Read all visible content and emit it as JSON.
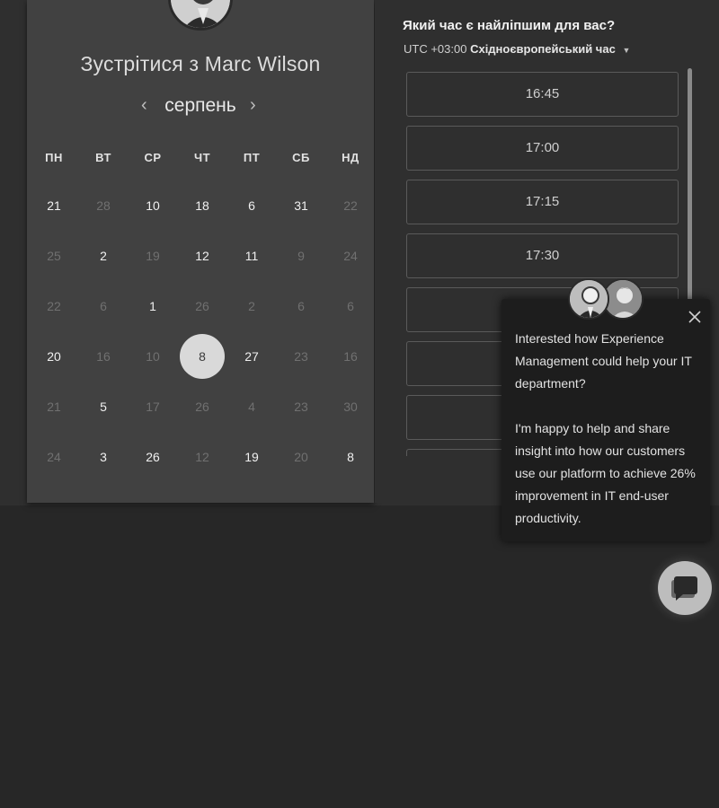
{
  "calendar": {
    "title": "Зустрітися з Marc Wilson",
    "month": "серпень",
    "prev_arrow": "‹",
    "next_arrow": "›",
    "weekdays": [
      "ПН",
      "ВТ",
      "СР",
      "ЧТ",
      "ПТ",
      "СБ",
      "НД"
    ],
    "weeks": [
      [
        {
          "d": "21",
          "dim": false
        },
        {
          "d": "28",
          "dim": true
        },
        {
          "d": "10",
          "dim": false
        },
        {
          "d": "18",
          "dim": false
        },
        {
          "d": "6",
          "dim": false
        },
        {
          "d": "31",
          "dim": false
        },
        {
          "d": "22",
          "dim": true
        }
      ],
      [
        {
          "d": "25",
          "dim": true
        },
        {
          "d": "2",
          "dim": false
        },
        {
          "d": "19",
          "dim": true
        },
        {
          "d": "12",
          "dim": false
        },
        {
          "d": "11",
          "dim": false
        },
        {
          "d": "9",
          "dim": true
        },
        {
          "d": "24",
          "dim": true
        }
      ],
      [
        {
          "d": "22",
          "dim": true
        },
        {
          "d": "6",
          "dim": true
        },
        {
          "d": "1",
          "dim": false
        },
        {
          "d": "26",
          "dim": true
        },
        {
          "d": "2",
          "dim": true
        },
        {
          "d": "6",
          "dim": true
        },
        {
          "d": "6",
          "dim": true
        }
      ],
      [
        {
          "d": "20",
          "dim": false
        },
        {
          "d": "16",
          "dim": true
        },
        {
          "d": "10",
          "dim": true
        },
        {
          "d": "8",
          "dim": false,
          "selected": true
        },
        {
          "d": "27",
          "dim": false
        },
        {
          "d": "23",
          "dim": true
        },
        {
          "d": "16",
          "dim": true
        }
      ],
      [
        {
          "d": "21",
          "dim": true
        },
        {
          "d": "5",
          "dim": false
        },
        {
          "d": "17",
          "dim": true
        },
        {
          "d": "26",
          "dim": true
        },
        {
          "d": "4",
          "dim": true
        },
        {
          "d": "23",
          "dim": true
        },
        {
          "d": "30",
          "dim": true
        }
      ],
      [
        {
          "d": "24",
          "dim": true
        },
        {
          "d": "3",
          "dim": false
        },
        {
          "d": "26",
          "dim": false
        },
        {
          "d": "12",
          "dim": true
        },
        {
          "d": "19",
          "dim": false
        },
        {
          "d": "20",
          "dim": true
        },
        {
          "d": "8",
          "dim": false
        }
      ]
    ]
  },
  "time": {
    "question": "Який час є найліпшим для вас?",
    "tz_offset": "UTC +03:00",
    "tz_name": "Східноєвропейський час",
    "tz_caret": "▼",
    "slots": [
      "16:45",
      "17:00",
      "17:15",
      "17:30",
      "",
      "",
      "",
      ""
    ]
  },
  "popup": {
    "para1": "Interested how Experience Management could help your IT department?",
    "para2": "I'm happy to help and share insight into how our customers use our platform to achieve 26% improvement in IT end-user productivity."
  },
  "colors": {
    "panel": "#414141",
    "selected_day": "#d9d9d9",
    "popup_bg": "#1d1d1d"
  }
}
